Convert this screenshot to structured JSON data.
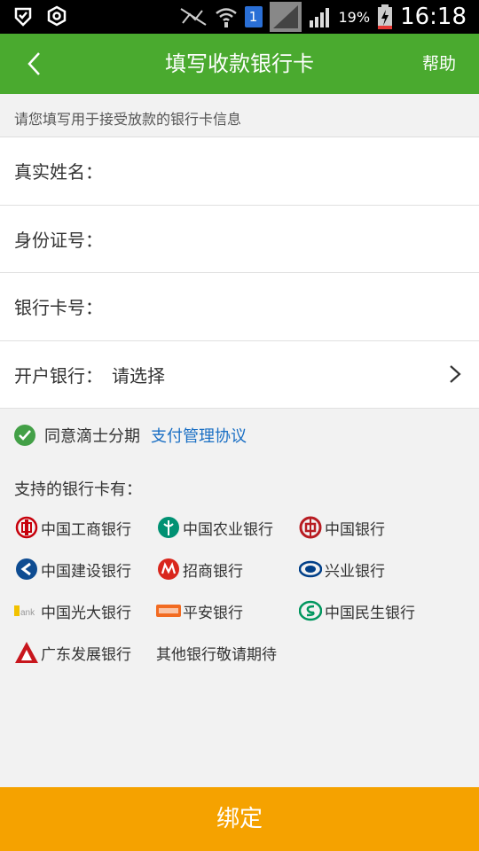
{
  "status_bar": {
    "badge": "1",
    "battery": "19%",
    "time": "16:18"
  },
  "header": {
    "title": "填写收款银行卡",
    "help": "帮助"
  },
  "hint": "请您填写用于接受放款的银行卡信息",
  "form": {
    "name_label": "真实姓名：",
    "id_label": "身份证号：",
    "card_label": "银行卡号：",
    "bank_label": "开户银行：",
    "bank_value": "请选择"
  },
  "agreement": {
    "text": "同意滴士分期",
    "link": "支付管理协议"
  },
  "support_title": "支持的银行卡有：",
  "banks": [
    {
      "name": "中国工商银行",
      "icon": "icbc-logo",
      "color": "#c7000b"
    },
    {
      "name": "中国农业银行",
      "icon": "abc-logo",
      "color": "#009173"
    },
    {
      "name": "中国银行",
      "icon": "boc-logo",
      "color": "#b81c22"
    },
    {
      "name": "中国建设银行",
      "icon": "ccb-logo",
      "color": "#0e4c92"
    },
    {
      "name": "招商银行",
      "icon": "cmb-logo",
      "color": "#d9261c"
    },
    {
      "name": "兴业银行",
      "icon": "cib-logo",
      "color": "#003f88"
    },
    {
      "name": "中国光大银行",
      "icon": "ceb-logo",
      "color": "#f2c200"
    },
    {
      "name": "平安银行",
      "icon": "pingan-logo",
      "color": "#f26b21"
    },
    {
      "name": "中国民生银行",
      "icon": "cmbc-logo",
      "color": "#00965e"
    },
    {
      "name": "广东发展银行",
      "icon": "cgb-logo",
      "color": "#c8161d"
    },
    {
      "name": "其他银行敬请期待",
      "icon": "",
      "color": ""
    }
  ],
  "bind_button": "绑定",
  "colors": {
    "header": "#4aaa2f",
    "button": "#f5a200",
    "link": "#1a6fc4"
  }
}
